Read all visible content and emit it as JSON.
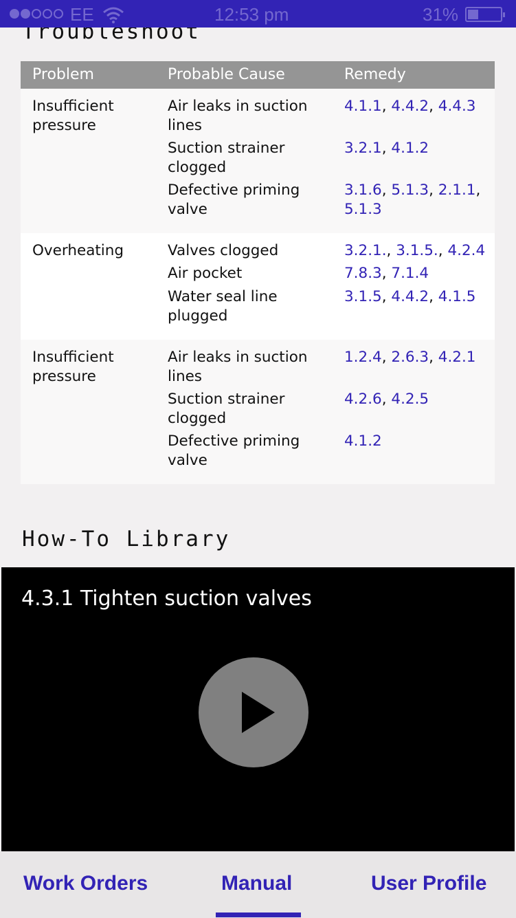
{
  "status_bar": {
    "carrier": "EE",
    "time": "12:53 pm",
    "battery_percent": "31%",
    "signal_bars_filled": 2,
    "signal_bars_total": 5,
    "battery_level": 0.31,
    "icons": [
      "signal-icon",
      "wifi-icon",
      "battery-icon"
    ]
  },
  "troubleshoot": {
    "title": "Troubleshoot",
    "headers": {
      "problem": "Problem",
      "cause": "Probable Cause",
      "remedy": "Remedy"
    },
    "groups": [
      {
        "problem": "Insufficient pressure",
        "rows": [
          {
            "cause": "Air leaks in suction lines",
            "remedies": [
              "4.1.1",
              "4.4.2",
              "4.4.3"
            ]
          },
          {
            "cause": "Suction strainer clogged",
            "remedies": [
              "3.2.1",
              "4.1.2"
            ]
          },
          {
            "cause": "Defective priming valve",
            "remedies": [
              "3.1.6",
              "5.1.3",
              "2.1.1",
              "5.1.3"
            ]
          }
        ]
      },
      {
        "problem": "Overheating",
        "rows": [
          {
            "cause": "Valves clogged",
            "remedies": [
              "3.2.1.",
              "3.1.5.",
              "4.2.4"
            ]
          },
          {
            "cause": "Air pocket",
            "remedies": [
              "7.8.3",
              "7.1.4"
            ]
          },
          {
            "cause": "Water seal line plugged",
            "remedies": [
              "3.1.5",
              "4.4.2",
              "4.1.5"
            ]
          }
        ]
      },
      {
        "problem": "Insufficient pressure",
        "rows": [
          {
            "cause": "Air leaks in suction lines",
            "remedies": [
              "1.2.4",
              "2.6.3",
              "4.2.1"
            ]
          },
          {
            "cause": "Suction strainer clogged",
            "remedies": [
              "4.2.6",
              "4.2.5"
            ]
          },
          {
            "cause": "Defective priming valve",
            "remedies": [
              "4.1.2"
            ]
          }
        ]
      }
    ]
  },
  "howto": {
    "title": "How-To Library",
    "video_title": "4.3.1 Tighten suction valves",
    "play_icon": "play-icon"
  },
  "nav": {
    "work_orders": "Work Orders",
    "manual": "Manual",
    "user_profile": "User Profile",
    "active": "manual"
  },
  "colors": {
    "accent": "#3223b5",
    "header_bg": "#959595",
    "video_bg": "#000000",
    "play_button": "#808080"
  }
}
